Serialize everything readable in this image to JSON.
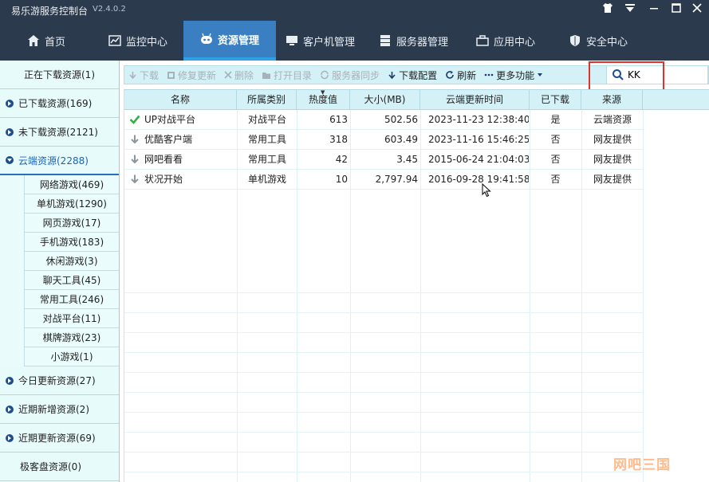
{
  "window": {
    "title": "易乐游服务控制台",
    "version": "V2.4.0.2"
  },
  "nav": [
    {
      "label": "首页",
      "icon": "home-icon"
    },
    {
      "label": "监控中心",
      "icon": "monitor-chart-icon"
    },
    {
      "label": "资源管理",
      "icon": "robot-icon",
      "active": true
    },
    {
      "label": "客户机管理",
      "icon": "computer-icon"
    },
    {
      "label": "服务器管理",
      "icon": "server-icon"
    },
    {
      "label": "应用中心",
      "icon": "briefcase-icon"
    },
    {
      "label": "安全中心",
      "icon": "shield-icon"
    }
  ],
  "sidebar": {
    "items": [
      {
        "label": "正在下载资源(1)"
      },
      {
        "label": "已下载资源(169)"
      },
      {
        "label": "未下载资源(2121)"
      },
      {
        "label": "云端资源(2288)"
      },
      {
        "label": "今日更新资源(27)"
      },
      {
        "label": "近期新增资源(2)"
      },
      {
        "label": "近期更新资源(69)"
      },
      {
        "label": "极客盘资源(0)"
      }
    ],
    "sub_items": [
      "网络游戏(469)",
      "单机游戏(1290)",
      "网页游戏(17)",
      "手机游戏(183)",
      "休闲游戏(3)",
      "聊天工具(45)",
      "常用工具(246)",
      "对战平台(11)",
      "棋牌游戏(23)",
      "小游戏(1)"
    ]
  },
  "toolbar": {
    "download": "下载",
    "repair": "修复更新",
    "delete": "删除",
    "open_dir": "打开目录",
    "server_sync": "服务器同步",
    "download_config": "下载配置",
    "refresh": "刷新",
    "more": "更多功能"
  },
  "search": {
    "value": "KK"
  },
  "table": {
    "headers": [
      "名称",
      "所属类别",
      "热度值",
      "大小(MB)",
      "云端更新时间",
      "已下载",
      "来源"
    ],
    "rows": [
      {
        "status": "check",
        "name": "UP对战平台",
        "category": "对战平台",
        "heat": "613",
        "size": "502.56",
        "updated": "2023-11-23 12:38:40",
        "downloaded": "是",
        "source": "云端资源"
      },
      {
        "status": "download",
        "name": "优酷客户端",
        "category": "常用工具",
        "heat": "318",
        "size": "603.49",
        "updated": "2023-11-16 15:46:25",
        "downloaded": "否",
        "source": "网友提供"
      },
      {
        "status": "download",
        "name": "网吧看看",
        "category": "常用工具",
        "heat": "42",
        "size": "3.45",
        "updated": "2015-06-24 21:04:03",
        "downloaded": "否",
        "source": "网友提供"
      },
      {
        "status": "download",
        "name": "状况开始",
        "category": "单机游戏",
        "heat": "10",
        "size": "2,797.94",
        "updated": "2016-09-28 19:41:58",
        "downloaded": "否",
        "source": "网友提供"
      }
    ]
  },
  "watermark": "网吧三国",
  "colors": {
    "titlebar": "#2b3a4c",
    "nav_active": "#3a7fc1",
    "sidebar_bg": "#e8fbfb",
    "header_bg": "#d4f1f7",
    "highlight": "#e0312b",
    "check": "#2fb14a"
  }
}
